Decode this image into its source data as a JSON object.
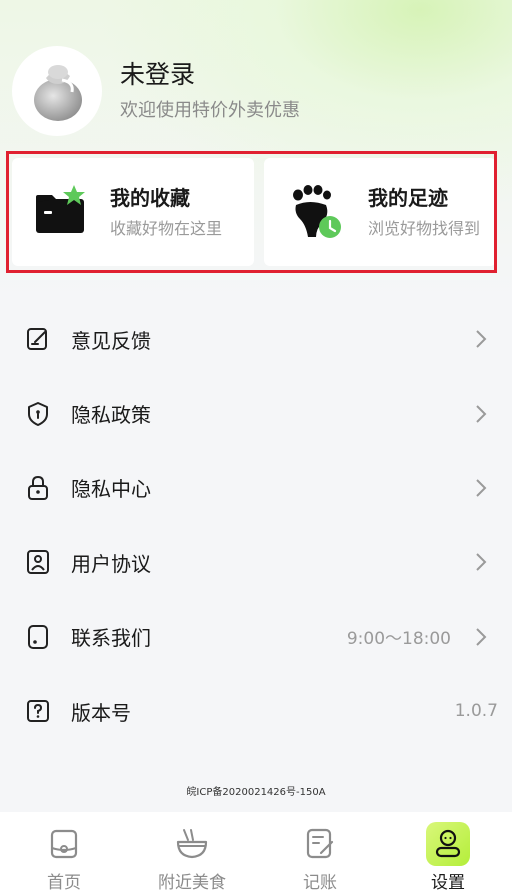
{
  "profile": {
    "name": "未登录",
    "subtitle": "欢迎使用特价外卖优惠"
  },
  "cards": [
    {
      "title": "我的收藏",
      "subtitle": "收藏好物在这里",
      "icon": "folder-star-icon"
    },
    {
      "title": "我的足迹",
      "subtitle": "浏览好物找得到",
      "icon": "footprint-clock-icon"
    }
  ],
  "menu": [
    {
      "label": "意见反馈",
      "value": "",
      "icon": "feedback-edit-icon",
      "chevron": true
    },
    {
      "label": "隐私政策",
      "value": "",
      "icon": "shield-icon",
      "chevron": true
    },
    {
      "label": "隐私中心",
      "value": "",
      "icon": "lock-icon",
      "chevron": true
    },
    {
      "label": "用户协议",
      "value": "",
      "icon": "user-doc-icon",
      "chevron": true
    },
    {
      "label": "联系我们",
      "value": "9:00～18:00",
      "icon": "phone-icon",
      "chevron": true
    },
    {
      "label": "版本号",
      "value": "1.0.7",
      "icon": "question-icon",
      "chevron": false
    }
  ],
  "icp": "皖ICP备2020021426号-150A",
  "tabs": [
    {
      "label": "首页",
      "icon": "home-icon",
      "active": false
    },
    {
      "label": "附近美食",
      "icon": "bowl-icon",
      "active": false
    },
    {
      "label": "记账",
      "icon": "notebook-icon",
      "active": false
    },
    {
      "label": "设置",
      "icon": "profile-settings-icon",
      "active": true
    }
  ],
  "colors": {
    "accent": "#b4ee3a",
    "star": "#5ec95a",
    "highlight_frame": "#e02030"
  }
}
